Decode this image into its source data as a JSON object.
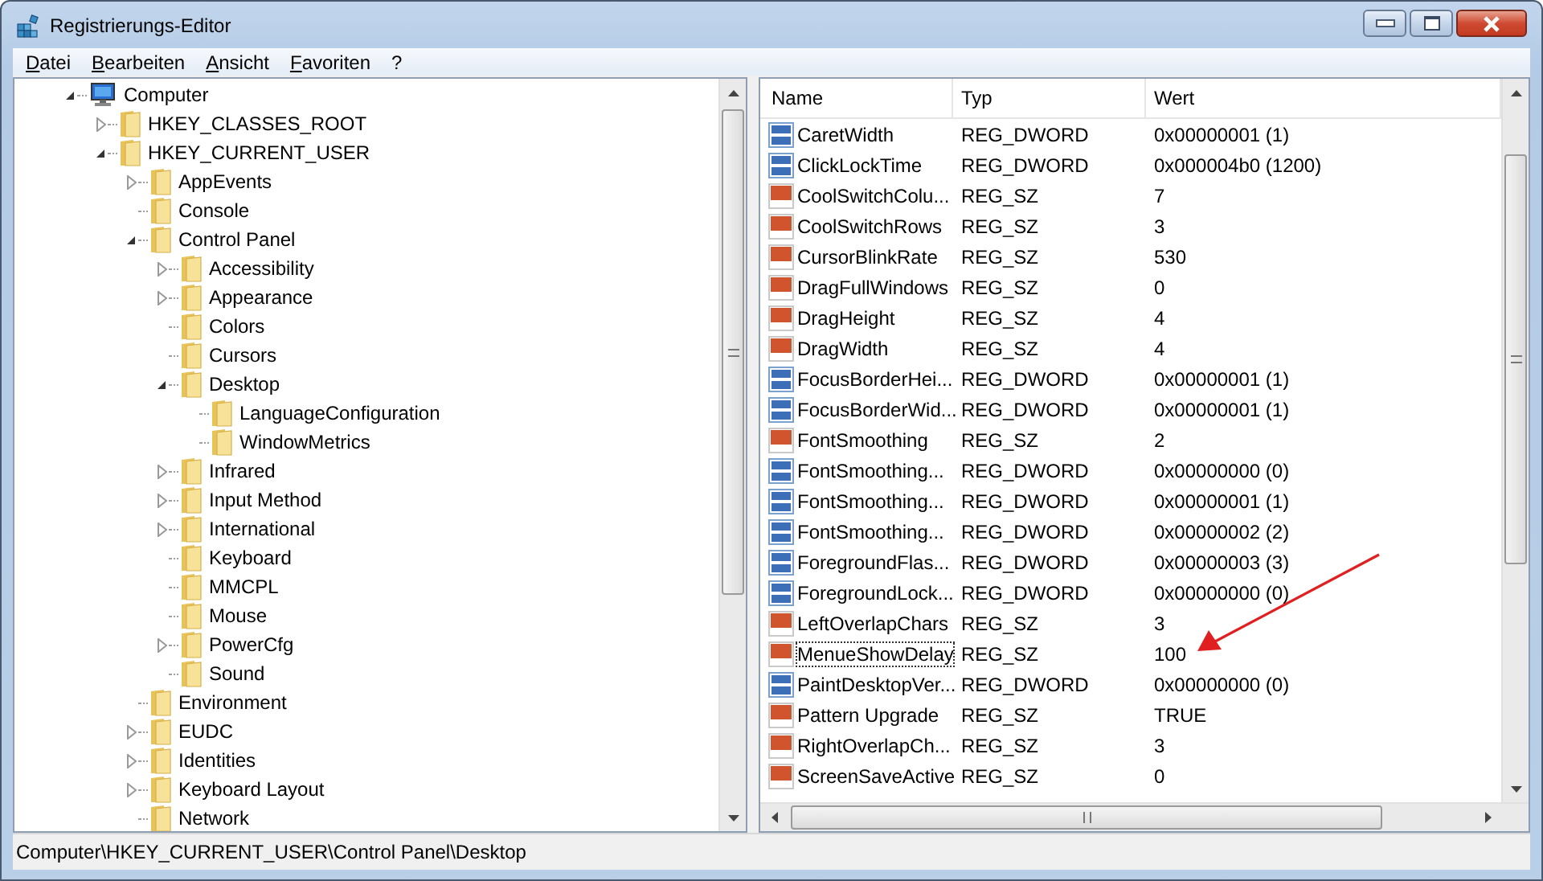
{
  "window": {
    "title": "Registrierungs-Editor"
  },
  "menu": [
    {
      "label": "Datei"
    },
    {
      "label": "Bearbeiten"
    },
    {
      "label": "Ansicht"
    },
    {
      "label": "Favoriten"
    },
    {
      "label": "?"
    }
  ],
  "tree": [
    {
      "label": "Computer",
      "kind": "computer",
      "expanded": true,
      "children": [
        {
          "label": "HKEY_CLASSES_ROOT",
          "expanded": false
        },
        {
          "label": "HKEY_CURRENT_USER",
          "expanded": true,
          "children": [
            {
              "label": "AppEvents",
              "expanded": false
            },
            {
              "label": "Console"
            },
            {
              "label": "Control Panel",
              "expanded": true,
              "children": [
                {
                  "label": "Accessibility",
                  "expanded": false
                },
                {
                  "label": "Appearance",
                  "expanded": false
                },
                {
                  "label": "Colors"
                },
                {
                  "label": "Cursors"
                },
                {
                  "label": "Desktop",
                  "expanded": true,
                  "children": [
                    {
                      "label": "LanguageConfiguration"
                    },
                    {
                      "label": "WindowMetrics"
                    }
                  ]
                },
                {
                  "label": "Infrared",
                  "expanded": false
                },
                {
                  "label": "Input Method",
                  "expanded": false
                },
                {
                  "label": "International",
                  "expanded": false
                },
                {
                  "label": "Keyboard"
                },
                {
                  "label": "MMCPL"
                },
                {
                  "label": "Mouse"
                },
                {
                  "label": "PowerCfg",
                  "expanded": false
                },
                {
                  "label": "Sound"
                }
              ]
            },
            {
              "label": "Environment"
            },
            {
              "label": "EUDC",
              "expanded": false
            },
            {
              "label": "Identities",
              "expanded": false
            },
            {
              "label": "Keyboard Layout",
              "expanded": false
            },
            {
              "label": "Network"
            }
          ]
        }
      ]
    }
  ],
  "table": {
    "columns": [
      "Name",
      "Typ",
      "Wert"
    ],
    "rows": [
      {
        "kind": "dword",
        "name": "CaretWidth",
        "type": "REG_DWORD",
        "value": "0x00000001 (1)",
        "focused": false
      },
      {
        "kind": "dword",
        "name": "ClickLockTime",
        "type": "REG_DWORD",
        "value": "0x000004b0 (1200)",
        "focused": false
      },
      {
        "kind": "sz",
        "name": "CoolSwitchColu...",
        "type": "REG_SZ",
        "value": "7",
        "focused": false
      },
      {
        "kind": "sz",
        "name": "CoolSwitchRows",
        "type": "REG_SZ",
        "value": "3",
        "focused": false
      },
      {
        "kind": "sz",
        "name": "CursorBlinkRate",
        "type": "REG_SZ",
        "value": "530",
        "focused": false
      },
      {
        "kind": "sz",
        "name": "DragFullWindows",
        "type": "REG_SZ",
        "value": "0",
        "focused": false
      },
      {
        "kind": "sz",
        "name": "DragHeight",
        "type": "REG_SZ",
        "value": "4",
        "focused": false
      },
      {
        "kind": "sz",
        "name": "DragWidth",
        "type": "REG_SZ",
        "value": "4",
        "focused": false
      },
      {
        "kind": "dword",
        "name": "FocusBorderHei...",
        "type": "REG_DWORD",
        "value": "0x00000001 (1)",
        "focused": false
      },
      {
        "kind": "dword",
        "name": "FocusBorderWid...",
        "type": "REG_DWORD",
        "value": "0x00000001 (1)",
        "focused": false
      },
      {
        "kind": "sz",
        "name": "FontSmoothing",
        "type": "REG_SZ",
        "value": "2",
        "focused": false
      },
      {
        "kind": "dword",
        "name": "FontSmoothing...",
        "type": "REG_DWORD",
        "value": "0x00000000 (0)",
        "focused": false
      },
      {
        "kind": "dword",
        "name": "FontSmoothing...",
        "type": "REG_DWORD",
        "value": "0x00000001 (1)",
        "focused": false
      },
      {
        "kind": "dword",
        "name": "FontSmoothing...",
        "type": "REG_DWORD",
        "value": "0x00000002 (2)",
        "focused": false
      },
      {
        "kind": "dword",
        "name": "ForegroundFlas...",
        "type": "REG_DWORD",
        "value": "0x00000003 (3)",
        "focused": false
      },
      {
        "kind": "dword",
        "name": "ForegroundLock...",
        "type": "REG_DWORD",
        "value": "0x00000000 (0)",
        "focused": false
      },
      {
        "kind": "sz",
        "name": "LeftOverlapChars",
        "type": "REG_SZ",
        "value": "3",
        "focused": false
      },
      {
        "kind": "sz",
        "name": "MenueShowDelay",
        "type": "REG_SZ",
        "value": "100",
        "focused": true
      },
      {
        "kind": "dword",
        "name": "PaintDesktopVer...",
        "type": "REG_DWORD",
        "value": "0x00000000 (0)",
        "focused": false
      },
      {
        "kind": "sz",
        "name": "Pattern Upgrade",
        "type": "REG_SZ",
        "value": "TRUE",
        "focused": false
      },
      {
        "kind": "sz",
        "name": "RightOverlapCh...",
        "type": "REG_SZ",
        "value": "3",
        "focused": false
      },
      {
        "kind": "sz",
        "name": "ScreenSaveActive",
        "type": "REG_SZ",
        "value": "0",
        "focused": false
      }
    ]
  },
  "status_bar": "Computer\\HKEY_CURRENT_USER\\Control Panel\\Desktop"
}
